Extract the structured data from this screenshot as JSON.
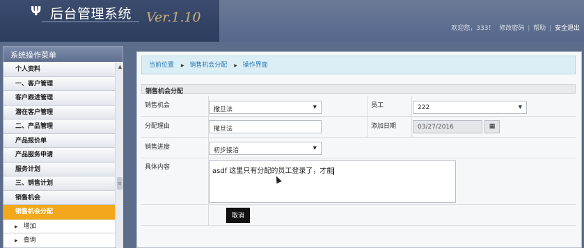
{
  "header": {
    "logo_symbol": "Ψ",
    "title": "后台管理系统",
    "version": "Ver.1.10",
    "welcome": "欢迎您，333！",
    "change_password": "修改密码",
    "help": "帮助",
    "logout": "安全退出"
  },
  "sidebar": {
    "title": "系统操作菜单",
    "items": [
      {
        "label": "个人资料"
      },
      {
        "label": "一、客户管理"
      },
      {
        "label": "客户跟进管理"
      },
      {
        "label": "潜在客户管理"
      },
      {
        "label": "二、产品管理"
      },
      {
        "label": "产品报价单"
      },
      {
        "label": "产品服务申请"
      },
      {
        "label": "服务计划"
      },
      {
        "label": "三、销售计划"
      },
      {
        "label": "销售机会"
      },
      {
        "label": "销售机会分配"
      },
      {
        "label": "增加"
      },
      {
        "label": "查询"
      }
    ]
  },
  "breadcrumb": {
    "current": "当前位置",
    "section": "销售机会分配",
    "page": "操作界面"
  },
  "form": {
    "caption": "销售机会分配",
    "opportunity_label": "销售机会",
    "opportunity_value": "撒旦法",
    "employee_label": "员工",
    "employee_value": "222",
    "reason_label": "分配理由",
    "reason_value": "撒旦法",
    "date_label": "添加日期",
    "date_value": "03/27/2016",
    "progress_label": "销售进度",
    "progress_value": "初步接洽",
    "content_label": "具体内容",
    "content_value": "asdf 这里只有分配的员工登录了，才能",
    "cancel_label": "取消"
  },
  "icons": {
    "calendar": "calendar-icon",
    "dropdown": "chevron-down-icon",
    "menu_arrow": "triangle-right-icon"
  },
  "colors": {
    "active_menu": "#f2a81a",
    "breadcrumb_text": "#2a7ab7",
    "header_bg": "#56678a"
  }
}
